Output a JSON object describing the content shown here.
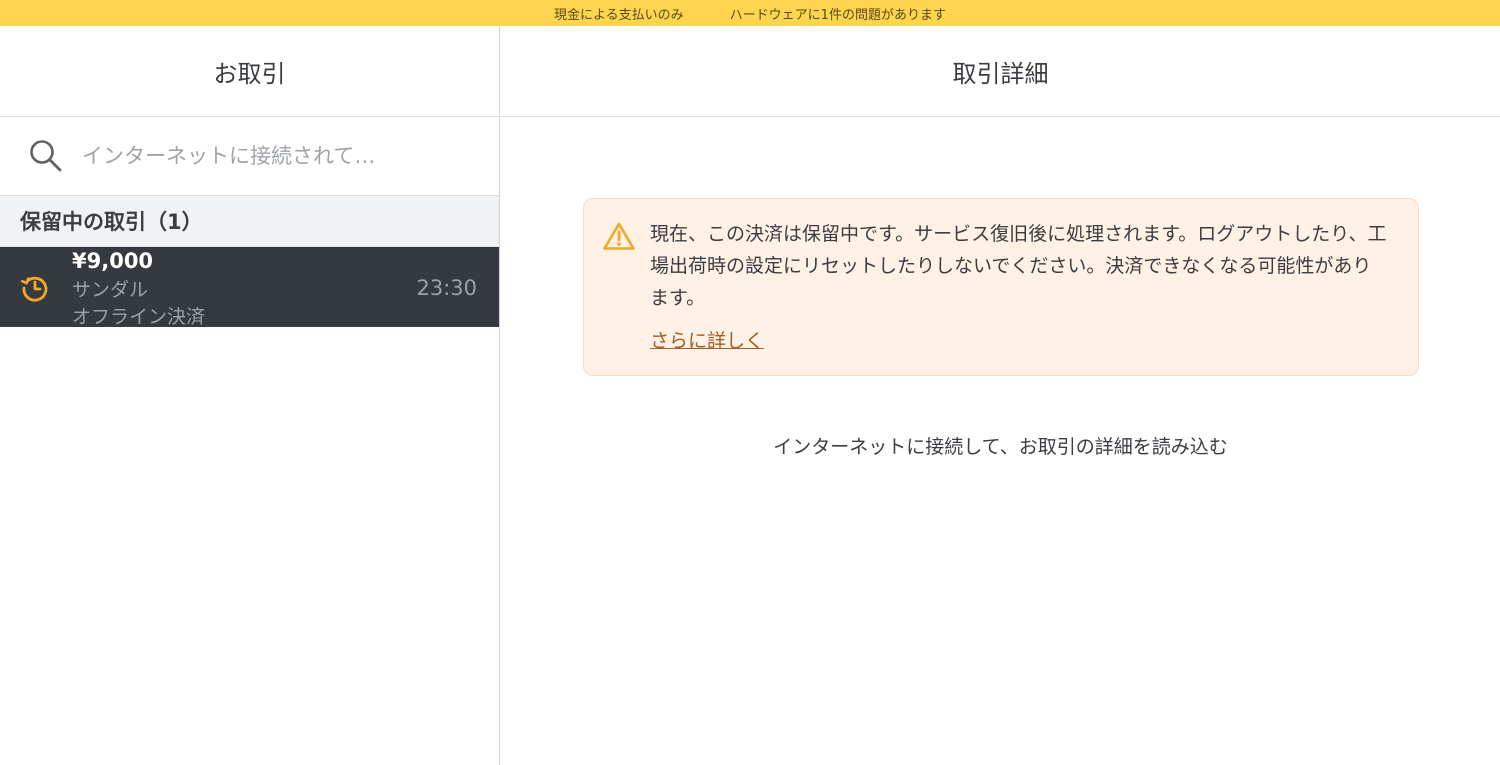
{
  "status_bar": {
    "cash_only": "現金による支払いのみ",
    "hardware_issue": "ハードウェアに1件の問題があります"
  },
  "left_pane": {
    "title": "お取引",
    "search": {
      "placeholder": "インターネットに接続されて…"
    },
    "section": "保留中の取引（1）",
    "transactions": [
      {
        "amount": "¥9,000",
        "item": "サンダル",
        "type": "オフライン決済",
        "time": "23:30",
        "icon": "pending-clock-icon"
      }
    ]
  },
  "right_pane": {
    "title": "取引詳細",
    "notice": {
      "icon": "warning-icon",
      "text": "現在、この決済は保留中です。サービス復旧後に処理されます。ログアウトしたり、工場出荷時の設定にリセットしたりしないでください。決済できなくなる可能性があります。",
      "link": "さらに詳しく"
    },
    "connect_message": "インターネットに接続して、お取引の詳細を読み込む"
  },
  "colors": {
    "status_bar": "#ffd54f",
    "selected_row": "#343a40",
    "pending_icon": "#f5a623",
    "notice_bg": "#fff1e6",
    "link": "#a0602a"
  }
}
